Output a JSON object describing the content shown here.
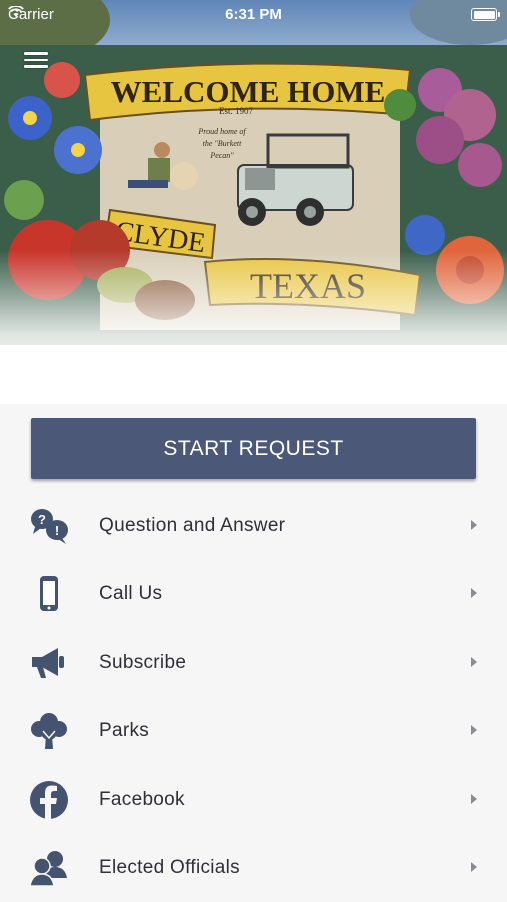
{
  "status_bar": {
    "carrier": "Carrier",
    "time": "6:31 PM"
  },
  "mural": {
    "welcome": "WELCOME HOME",
    "est": "Est. 1907",
    "tagline_1": "Proud home of",
    "tagline_2": "the \"Burkett",
    "tagline_3": "Pecan\"",
    "city": "CLYDE",
    "state": "TEXAS"
  },
  "main": {
    "start_button": "START REQUEST",
    "items": [
      {
        "label": "Question and Answer",
        "icon": "question-answer-icon"
      },
      {
        "label": "Call Us",
        "icon": "phone-icon"
      },
      {
        "label": "Subscribe",
        "icon": "megaphone-icon"
      },
      {
        "label": "Parks",
        "icon": "tree-icon"
      },
      {
        "label": "Facebook",
        "icon": "facebook-icon"
      },
      {
        "label": "Elected Officials",
        "icon": "officials-icon"
      }
    ]
  },
  "colors": {
    "accent": "#4b5878",
    "background": "#f6f6f7",
    "text": "#2f2f38",
    "chevron": "#8a8c94"
  }
}
